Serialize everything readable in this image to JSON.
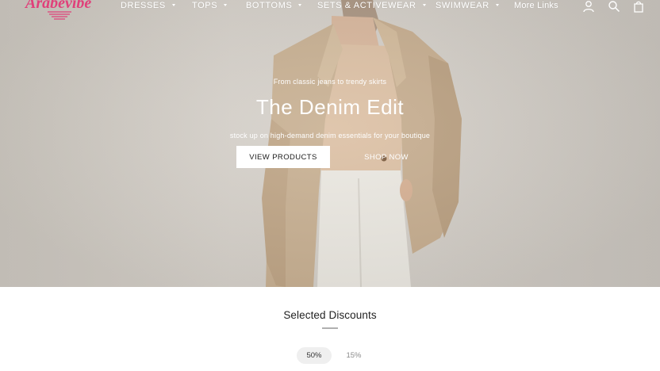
{
  "brand": {
    "logo_text": "Arabevibe",
    "accent_color": "#e0407a"
  },
  "nav": {
    "items": [
      {
        "label": "DRESSES",
        "has_dropdown": true
      },
      {
        "label": "TOPS",
        "has_dropdown": true
      },
      {
        "label": "BOTTOMS",
        "has_dropdown": true
      },
      {
        "label": "SETS & ACTIVEWEAR",
        "has_dropdown": true
      },
      {
        "label": "SWIMWEAR",
        "has_dropdown": true
      },
      {
        "label": "More Links",
        "has_dropdown": false
      }
    ],
    "icons": [
      "account-icon",
      "search-icon",
      "cart-icon"
    ]
  },
  "hero": {
    "eyebrow": "From classic jeans to trendy skirts",
    "title": "The Denim Edit",
    "subtitle": "stock up on high-demand denim essentials for your boutique",
    "primary_button": "VIEW PRODUCTS",
    "secondary_button": "SHOP NOW"
  },
  "discounts": {
    "title": "Selected Discounts",
    "tabs": [
      {
        "label": "50%",
        "active": true
      },
      {
        "label": "15%",
        "active": false
      }
    ]
  }
}
